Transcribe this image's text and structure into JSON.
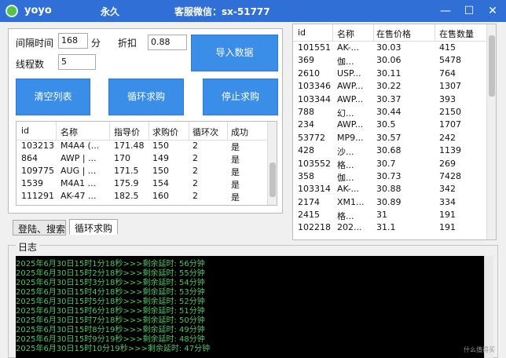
{
  "titlebar": {
    "app_name": "yoyo",
    "mode": "永久",
    "contact": "客服微信：sx-51777",
    "minimize": "—",
    "maximize": "☐",
    "close": "✕"
  },
  "settings": {
    "interval_label": "间隔时间",
    "interval_value": "168",
    "interval_unit": "分",
    "discount_label": "折扣",
    "discount_value": "0.88",
    "threads_label": "线程数",
    "threads_value": "5"
  },
  "buttons": {
    "import": "导入数据",
    "clear": "清空列表",
    "loop_buy": "循环求购",
    "stop_buy": "停止求购"
  },
  "left_table": {
    "columns": [
      "id",
      "名称",
      "指导价",
      "求购价",
      "循环次",
      "成功"
    ],
    "rows": [
      [
        "103213",
        "M4A4 (...",
        "171.48",
        "150",
        "2",
        "是"
      ],
      [
        "864",
        "AWP | ...",
        "170",
        "149",
        "2",
        "是"
      ],
      [
        "109775",
        "AUG | ...",
        "171.5",
        "150",
        "2",
        "是"
      ],
      [
        "1539",
        "M4A1 ...",
        "175.9",
        "154",
        "2",
        "是"
      ],
      [
        "111291",
        "AK-47 ...",
        "182.5",
        "160",
        "2",
        "是"
      ]
    ]
  },
  "tabs": [
    "登陆、搜索",
    "循环求购"
  ],
  "right_table": {
    "columns": [
      "id",
      "名称",
      "在售价格",
      "在售数量"
    ],
    "rows": [
      [
        "101551",
        "AK-...",
        "30.03",
        "415"
      ],
      [
        "369",
        "伽...",
        "30.06",
        "5478"
      ],
      [
        "2610",
        "USP...",
        "30.11",
        "764"
      ],
      [
        "103346",
        "AWP...",
        "30.22",
        "1307"
      ],
      [
        "103344",
        "AWP...",
        "30.37",
        "393"
      ],
      [
        "788",
        "幻...",
        "30.44",
        "2150"
      ],
      [
        "234",
        "AWP...",
        "30.5",
        "1707"
      ],
      [
        "53772",
        "MP9...",
        "30.57",
        "242"
      ],
      [
        "428",
        "沙...",
        "30.68",
        "1139"
      ],
      [
        "103552",
        "格...",
        "30.7",
        "269"
      ],
      [
        "358",
        "伽...",
        "30.73",
        "7428"
      ],
      [
        "103314",
        "AK-...",
        "30.88",
        "342"
      ],
      [
        "2174",
        "XM1...",
        "30.89",
        "334"
      ],
      [
        "2415",
        "格...",
        "31",
        "191"
      ],
      [
        "102218",
        "202...",
        "31.1",
        "191"
      ]
    ]
  },
  "log": {
    "title": "日志",
    "lines": [
      "2025年6月30日15时1分18秒>>>剩余延时: 56分钟",
      "2025年6月30日15时2分18秒>>>剩余延时: 55分钟",
      "2025年6月30日15时3分18秒>>>剩余延时: 54分钟",
      "2025年6月30日15时4分18秒>>>剩余延时: 53分钟",
      "2025年6月30日15时5分18秒>>>剩余延时: 52分钟",
      "2025年6月30日15时6分18秒>>>剩余延时: 51分钟",
      "2025年6月30日15时7分18秒>>>剩余延时: 50分钟",
      "2025年6月30日15时8分19秒>>>剩余延时: 49分钟",
      "2025年6月30日15时9分19秒>>>剩余延时: 48分钟",
      "2025年6月30日15时10分19秒>>>剩余延时: 47分钟"
    ],
    "color": "#4fc46a"
  },
  "watermark": "什么值得买"
}
